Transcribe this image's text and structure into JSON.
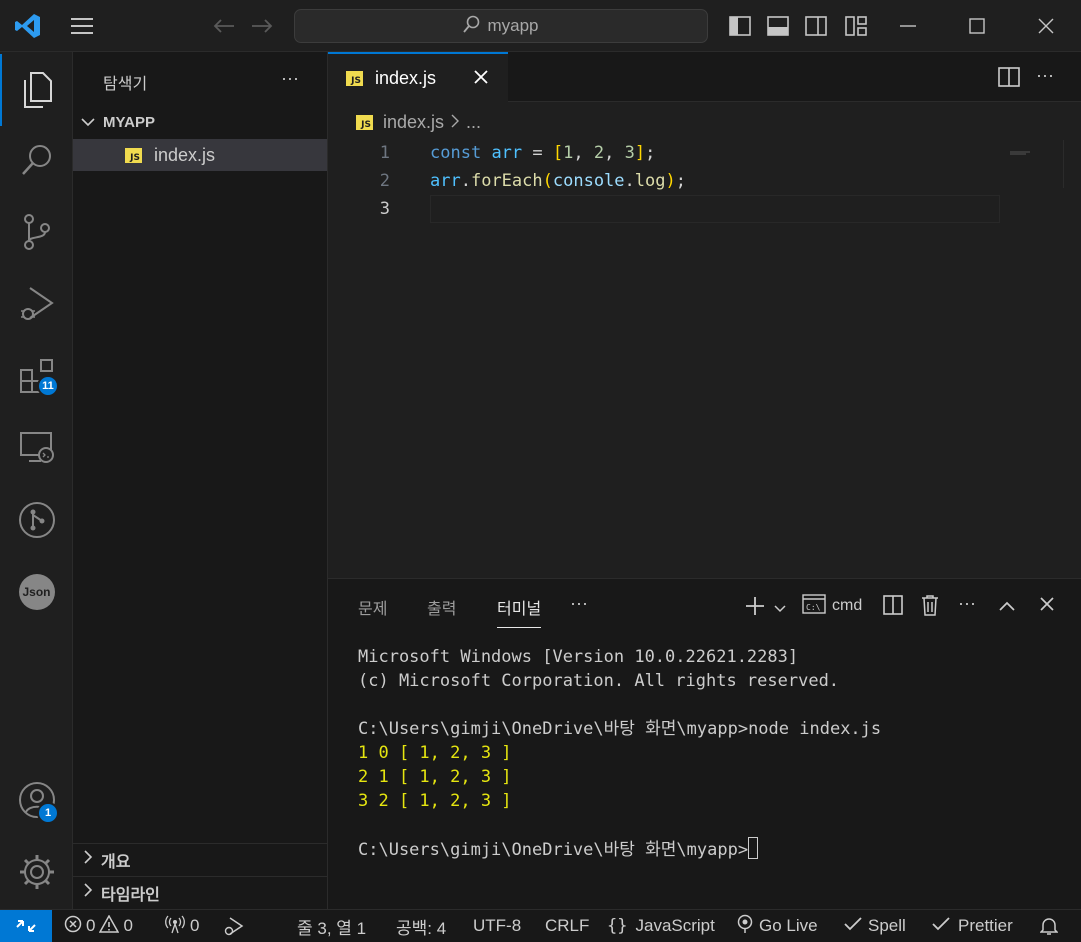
{
  "titlebar": {
    "search_text": "myapp"
  },
  "activity": {
    "extensions_badge": "11",
    "accounts_badge": "1",
    "json_label": "Json"
  },
  "sidebar": {
    "title": "탐색기",
    "more": "···",
    "folder": "MYAPP",
    "files": [
      {
        "name": "index.js",
        "icon": "JS"
      }
    ],
    "sections": [
      "개요",
      "타임라인"
    ]
  },
  "editor": {
    "tab_label": "index.js",
    "tab_icon": "JS",
    "breadcrumb_file": "index.js",
    "breadcrumb_more": "...",
    "line_numbers": [
      "1",
      "2",
      "3"
    ],
    "more": "···"
  },
  "panel": {
    "tabs": [
      "문제",
      "출력",
      "터미널"
    ],
    "more": "···",
    "terminal_name": "cmd",
    "terminal_lines": [
      "Microsoft Windows [Version 10.0.22621.2283]",
      "(c) Microsoft Corporation. All rights reserved.",
      "",
      "C:\\Users\\gimji\\OneDrive\\바탕 화면\\myapp>node index.js",
      "1 0 [ 1, 2, 3 ]",
      "2 1 [ 1, 2, 3 ]",
      "3 2 [ 1, 2, 3 ]",
      "",
      "C:\\Users\\gimji\\OneDrive\\바탕 화면\\myapp>"
    ]
  },
  "statusbar": {
    "errors": "0",
    "warnings": "0",
    "ports": "0",
    "position": "줄 3, 열 1",
    "spaces": "공백: 4",
    "encoding": "UTF-8",
    "eol": "CRLF",
    "language": "JavaScript",
    "golive": "Go Live",
    "spell": "Spell",
    "prettier": "Prettier"
  },
  "colors": {
    "accent": "#0078d4",
    "js_yellow": "#f0db4f"
  }
}
